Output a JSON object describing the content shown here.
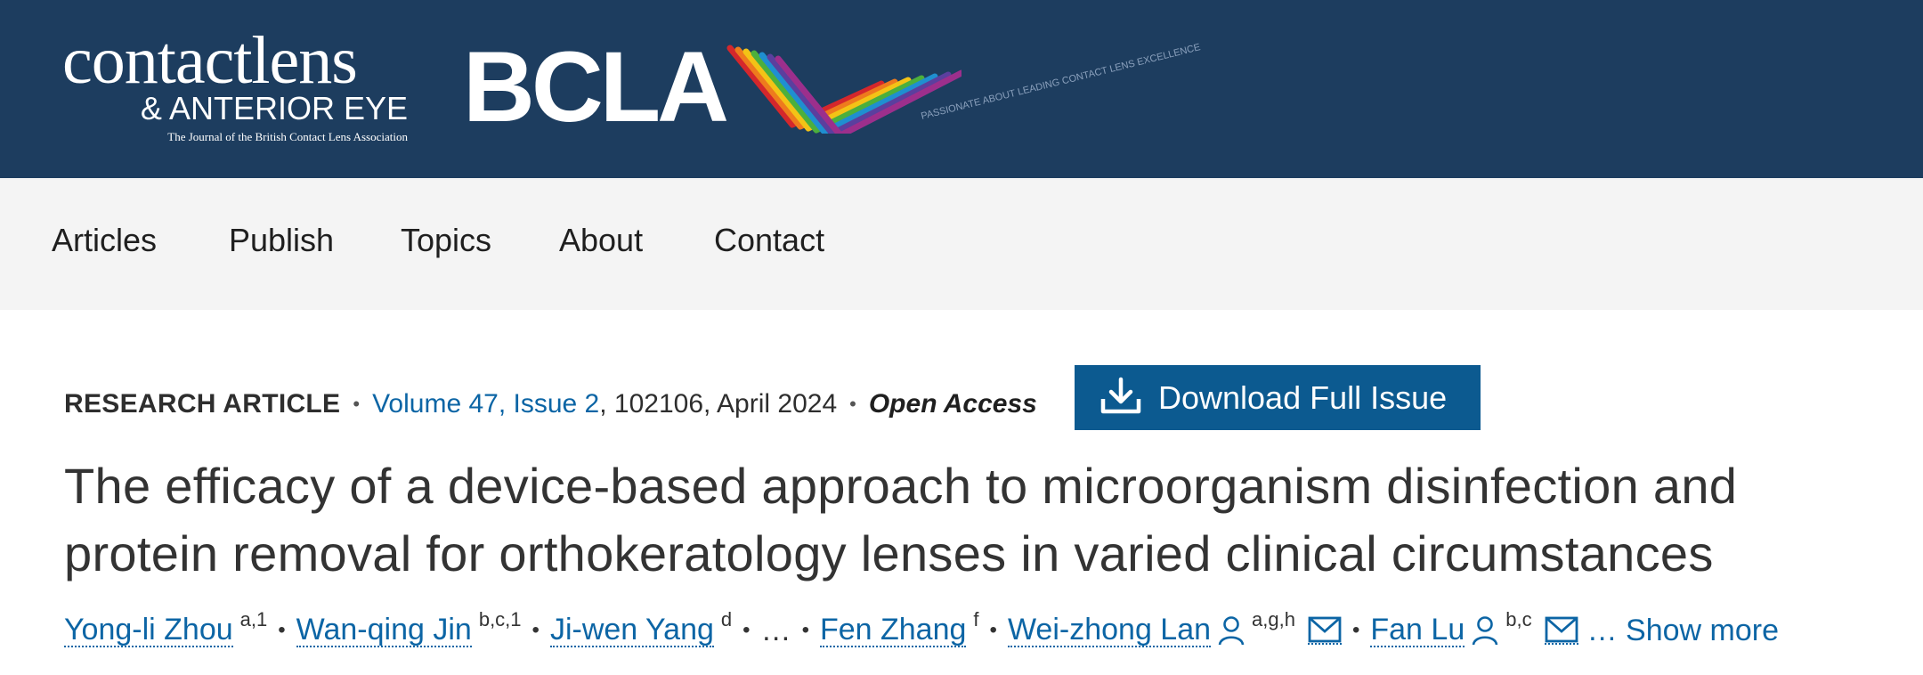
{
  "header": {
    "journal_logo": {
      "line1": "contactlens",
      "line2": "& ANTERIOR EYE",
      "line3": "The Journal of the British Contact Lens Association"
    },
    "partner_logo": {
      "text": "BCLA",
      "tagline": "PASSIONATE ABOUT LEADING CONTACT LENS EXCELLENCE",
      "stripe_colors": [
        "#d4272c",
        "#ee7b1d",
        "#f3c316",
        "#4caf3c",
        "#1f8fd0",
        "#5b3f9e",
        "#9c2f8c"
      ]
    },
    "bg_color": "#1d3d5f"
  },
  "nav": {
    "items": [
      "Articles",
      "Publish",
      "Topics",
      "About",
      "Contact"
    ]
  },
  "article": {
    "type_label": "RESEARCH ARTICLE",
    "volume_link": "Volume 47, Issue 2",
    "citation": ", 102106, April 2024",
    "access": "Open Access",
    "download_label": "Download Full Issue",
    "title": "The efficacy of a device-based approach to microorganism disinfection and protein removal for orthokeratology lenses in varied clinical circumstances",
    "authors": [
      {
        "name": "Yong-li Zhou",
        "sup": "a,1"
      },
      {
        "name": "Wan-qing Jin",
        "sup": "b,c,1"
      },
      {
        "name": "Ji-wen Yang",
        "sup": "d"
      },
      {
        "name": "Fen Zhang",
        "sup": "f"
      },
      {
        "name": "Wei-zhong Lan",
        "sup": "a,g,h"
      },
      {
        "name": "Fan Lu",
        "sup": "b,c"
      }
    ],
    "ellipsis": "…",
    "show_more": "… Show more",
    "link_color": "#0c65a5",
    "button_color": "#0c5a90"
  }
}
